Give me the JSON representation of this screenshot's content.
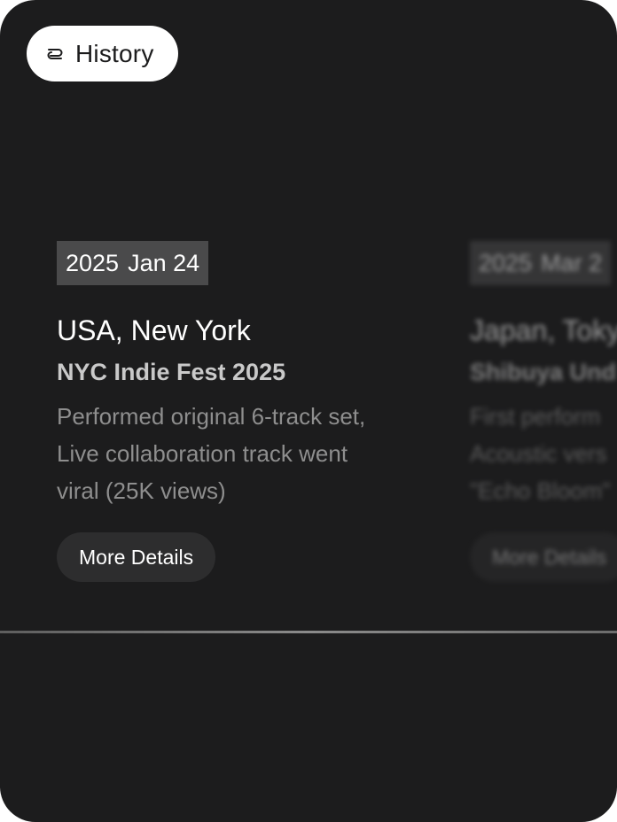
{
  "header": {
    "history_label": "History",
    "history_icon": "swap-icon"
  },
  "colors": {
    "panel_bg": "#1c1c1d",
    "badge_bg": "#4a4a4b",
    "button_bg": "#2d2d2e"
  },
  "entries": [
    {
      "year": "2025",
      "date": "Jan 24",
      "location": "USA, New York",
      "event": "NYC Indie Fest 2025",
      "description": [
        "Performed original 6-track set,",
        "Live collaboration track went",
        "viral (25K views)"
      ],
      "button_label": "More Details"
    },
    {
      "year": "2025",
      "date": "Mar 2",
      "location": "Japan, Toky",
      "event": "Shibuya Und",
      "description": [
        "First perform",
        "Acoustic vers",
        "\"Echo Bloom\""
      ],
      "button_label": "More Details"
    }
  ]
}
